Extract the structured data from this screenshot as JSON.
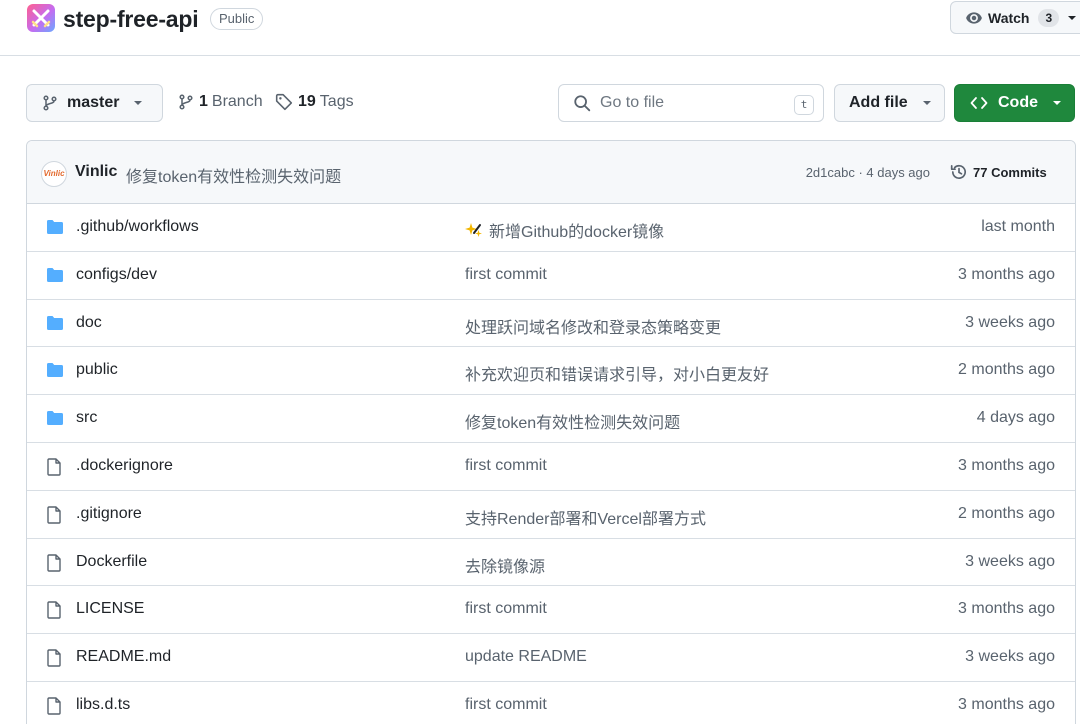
{
  "repo": {
    "name": "step-free-api",
    "visibility": "Public",
    "watch_label": "Watch",
    "watch_count": "3"
  },
  "toolbar": {
    "branch": "master",
    "branches_count": "1",
    "branches_label": "Branch",
    "tags_count": "19",
    "tags_label": "Tags",
    "search_placeholder": "Go to file",
    "search_shortcut": "t",
    "add_file_label": "Add file",
    "code_label": "Code"
  },
  "latest_commit": {
    "avatar_text": "Vinlic",
    "author": "Vinlic",
    "message": "修复token有效性检测失效问题",
    "meta": "2d1cabc · 4 days ago",
    "commits_label": "77 Commits"
  },
  "files": [
    {
      "type": "dir",
      "name": ".github/workflows",
      "message": "新增Github的docker镜像",
      "age": "last month",
      "emoji": "sparkles"
    },
    {
      "type": "dir",
      "name": "configs/dev",
      "message": "first commit",
      "age": "3 months ago"
    },
    {
      "type": "dir",
      "name": "doc",
      "message": "处理跃问域名修改和登录态策略变更",
      "age": "3 weeks ago"
    },
    {
      "type": "dir",
      "name": "public",
      "message": "补充欢迎页和错误请求引导，对小白更友好",
      "age": "2 months ago"
    },
    {
      "type": "dir",
      "name": "src",
      "message": "修复token有效性检测失效问题",
      "age": "4 days ago"
    },
    {
      "type": "file",
      "name": ".dockerignore",
      "message": "first commit",
      "age": "3 months ago"
    },
    {
      "type": "file",
      "name": ".gitignore",
      "message": "支持Render部署和Vercel部署方式",
      "age": "2 months ago"
    },
    {
      "type": "file",
      "name": "Dockerfile",
      "message": "去除镜像源",
      "age": "3 weeks ago"
    },
    {
      "type": "file",
      "name": "LICENSE",
      "message": "first commit",
      "age": "3 months ago"
    },
    {
      "type": "file",
      "name": "README.md",
      "message": "update README",
      "age": "3 weeks ago"
    },
    {
      "type": "file",
      "name": "libs.d.ts",
      "message": "first commit",
      "age": "3 months ago"
    }
  ],
  "colors": {
    "accent_green": "#1f883d",
    "folder_blue": "#54aeff",
    "muted_text": "#59636e"
  }
}
